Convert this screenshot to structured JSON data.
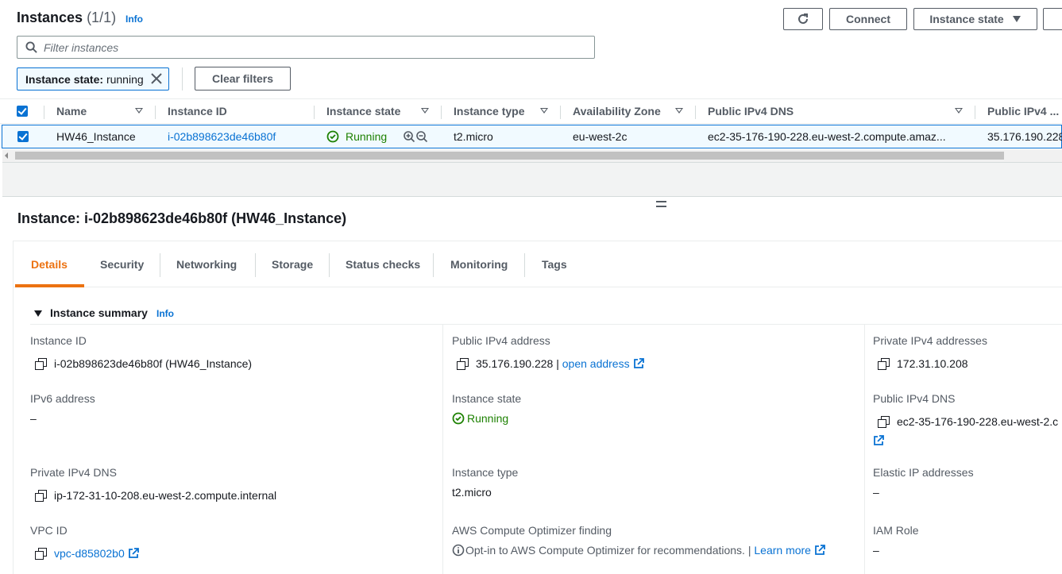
{
  "header": {
    "title": "Instances",
    "count": "(1/1)",
    "info": "Info",
    "connect_label": "Connect",
    "instance_state_label": "Instance state"
  },
  "search": {
    "placeholder": "Filter instances"
  },
  "filter": {
    "key": "Instance state:",
    "value": "running",
    "clear_label": "Clear filters"
  },
  "table": {
    "columns": [
      "Name",
      "Instance ID",
      "Instance state",
      "Instance type",
      "Availability Zone",
      "Public IPv4 DNS",
      "Public IPv4 ..."
    ],
    "row": {
      "name": "HW46_Instance",
      "instance_id": "i-02b898623de46b80f",
      "state": "Running",
      "type": "t2.micro",
      "az": "eu-west-2c",
      "public_dns": "ec2-35-176-190-228.eu-west-2.compute.amaz...",
      "public_ip": "35.176.190.228"
    }
  },
  "detail": {
    "title": "Instance: i-02b898623de46b80f (HW46_Instance)",
    "tabs": [
      "Details",
      "Security",
      "Networking",
      "Storage",
      "Status checks",
      "Monitoring",
      "Tags"
    ],
    "summary_title": "Instance summary",
    "summary_info": "Info",
    "fields": {
      "instance_id_label": "Instance ID",
      "instance_id_value": "i-02b898623de46b80f (HW46_Instance)",
      "ipv6_label": "IPv6 address",
      "ipv6_value": "–",
      "private_dns_label": "Private IPv4 DNS",
      "private_dns_value": "ip-172-31-10-208.eu-west-2.compute.internal",
      "vpc_label": "VPC ID",
      "vpc_value": "vpc-d85802b0",
      "public_ip_label": "Public IPv4 address",
      "public_ip_value": "35.176.190.228",
      "public_ip_sep": "|",
      "open_address": "open address",
      "state_label": "Instance state",
      "state_value": "Running",
      "type_label": "Instance type",
      "type_value": "t2.micro",
      "optimizer_label": "AWS Compute Optimizer finding",
      "optimizer_value": "Opt-in to AWS Compute Optimizer for recommendations.",
      "optimizer_sep": "|",
      "learn_more": "Learn more",
      "private_ips_label": "Private IPv4 addresses",
      "private_ips_value": "172.31.10.208",
      "public_dns_label": "Public IPv4 DNS",
      "public_dns_value": "ec2-35-176-190-228.eu-west-2.c",
      "elastic_label": "Elastic IP addresses",
      "elastic_value": "–",
      "iam_label": "IAM Role",
      "iam_value": "–"
    }
  },
  "colors": {
    "accent": "#ec7211",
    "link": "#0972d3",
    "success": "#1d8102"
  }
}
